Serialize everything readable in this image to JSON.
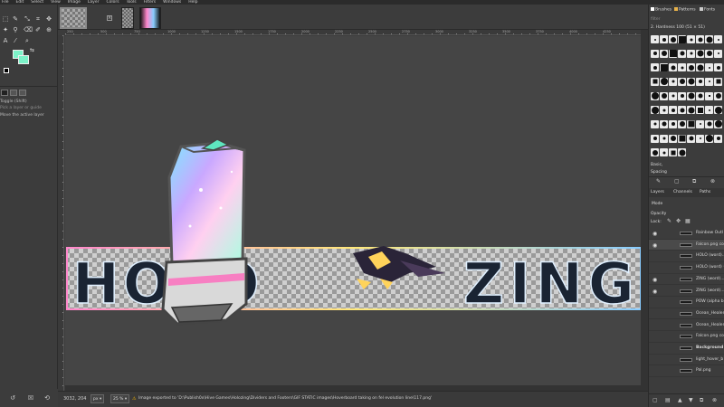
{
  "menubar": {
    "items": [
      "File",
      "Edit",
      "Select",
      "View",
      "Image",
      "Layer",
      "Colors",
      "Tools",
      "Filters",
      "Windows",
      "Help"
    ]
  },
  "toolbox": {
    "fg_color": "#7cf2c8",
    "bg_color": "#7cf2c8",
    "options_tool": "Toggle",
    "options_shortcut": "(Shift)",
    "options_line1": "Pick a layer or guide",
    "options_line2": "Move the active layer"
  },
  "rulers": {
    "top": [
      "250",
      "500",
      "750",
      "1000",
      "1250",
      "1500",
      "1750",
      "2000",
      "2250",
      "2500",
      "2750",
      "3000",
      "3250",
      "3500",
      "3750",
      "4000",
      "4250"
    ]
  },
  "statusbar": {
    "coords": "3032, 204",
    "unit": "px",
    "zoom": "25 %",
    "message": "Image exported to 'D:\\Publish0x\\Hive Games\\Holozing\\Dividers and Footers\\GIF STATIC images\\Hoverboard taking on fel evolution line\\117.png'"
  },
  "right_panel": {
    "tabs": [
      "Brushes",
      "Patterns",
      "Fonts"
    ],
    "filter_placeholder": "filter",
    "brush_name": "2. Hardness 100 (51 × 51)",
    "preset": "Basic,",
    "spacing_label": "Spacing",
    "layers_tabs": [
      "Layers",
      "Channels",
      "Paths"
    ],
    "mode_label": "Mode",
    "opacity_label": "Opacity",
    "lock_label": "Lock:",
    "layers": [
      {
        "name": "Rainbow Outl",
        "visible": true,
        "bold": false
      },
      {
        "name": "Falcon.png copy",
        "visible": true,
        "bold": false
      },
      {
        "name": "HOLO (word)...",
        "visible": false,
        "bold": false
      },
      {
        "name": "HOLO (word) #1",
        "visible": false,
        "bold": false
      },
      {
        "name": "ZING (word)...",
        "visible": true,
        "bold": false
      },
      {
        "name": "ZING (word)...",
        "visible": true,
        "bold": false
      },
      {
        "name": "POW (alpha bu",
        "visible": false,
        "bold": false
      },
      {
        "name": "Ocean_Healer",
        "visible": false,
        "bold": false
      },
      {
        "name": "Ocean_Healer",
        "visible": false,
        "bold": false
      },
      {
        "name": "Falcon.png copy",
        "visible": false,
        "bold": false
      },
      {
        "name": "Background",
        "visible": false,
        "bold": true
      },
      {
        "name": "light_hover_b",
        "visible": false,
        "bold": false
      },
      {
        "name": "Pal.png",
        "visible": false,
        "bold": false
      }
    ]
  },
  "canvas": {
    "banner_left_text": "HOLO",
    "banner_right_text": "ZING"
  }
}
